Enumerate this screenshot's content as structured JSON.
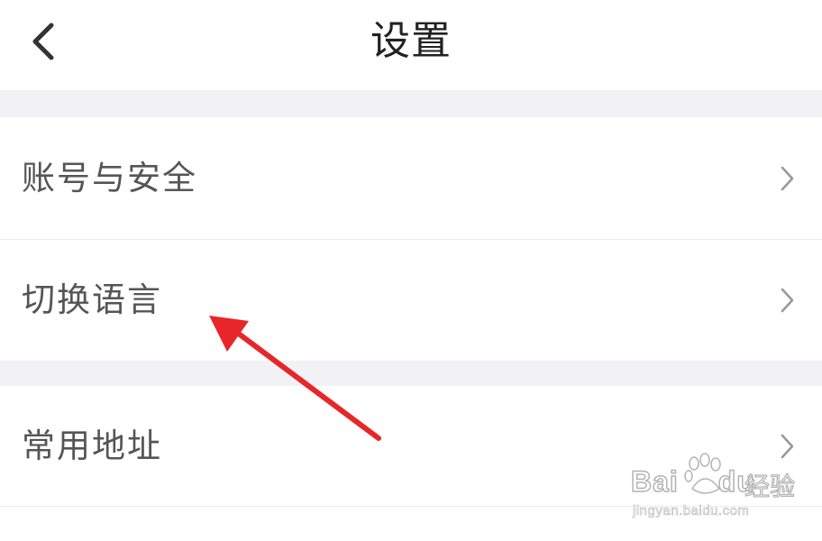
{
  "header": {
    "title": "设置",
    "back_icon": "chevron-left-icon"
  },
  "settings": {
    "items": [
      {
        "label": "账号与安全",
        "icon": "chevron-right-icon"
      },
      {
        "label": "切换语言",
        "icon": "chevron-right-icon"
      },
      {
        "label": "常用地址",
        "icon": "chevron-right-icon"
      }
    ]
  },
  "annotation": {
    "icon": "red-arrow-pointer",
    "color": "#e8262a"
  },
  "watermark": {
    "brand": "Bai",
    "brand_mid": "du",
    "text": "经验",
    "url": "jingyan.baidu.com"
  },
  "colors": {
    "title": "#222222",
    "label": "#555555",
    "chevron": "#999999",
    "section_gap": "#f2f2f4"
  }
}
